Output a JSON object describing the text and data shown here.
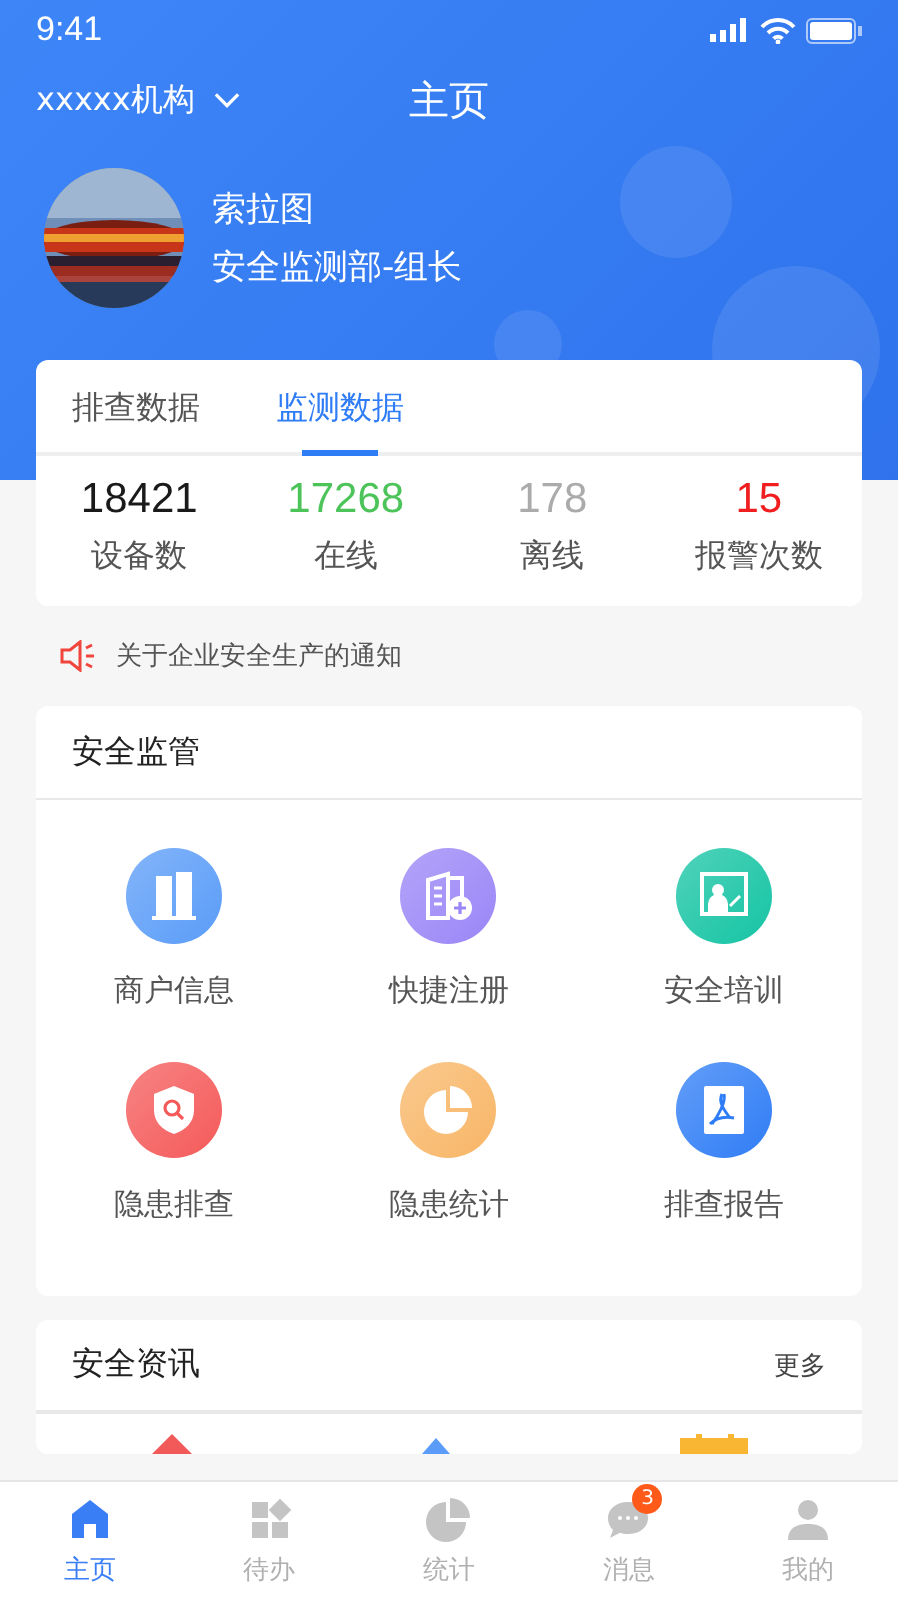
{
  "status_bar": {
    "time": "9:41"
  },
  "header": {
    "org": "xxxxx机构",
    "title": "主页"
  },
  "profile": {
    "name": "索拉图",
    "role": "安全监测部-组长"
  },
  "tabs": [
    {
      "label": "排查数据",
      "selected": false
    },
    {
      "label": "监测数据",
      "selected": true
    }
  ],
  "stats": [
    {
      "value": "18421",
      "label": "设备数",
      "color": "#1a1a1a"
    },
    {
      "value": "17268",
      "label": "在线",
      "color": "#4cc45a"
    },
    {
      "value": "178",
      "label": "离线",
      "color": "#ababab"
    },
    {
      "value": "15",
      "label": "报警次数",
      "color": "#f01e1e"
    }
  ],
  "notice": {
    "text": "关于企业安全生产的通知"
  },
  "supervision": {
    "title": "安全监管",
    "items": [
      {
        "label": "商户信息",
        "kind": "building",
        "color": "#5a9cf8"
      },
      {
        "label": "快捷注册",
        "kind": "register",
        "color": "#9b86f7"
      },
      {
        "label": "安全培训",
        "kind": "training",
        "color": "#15c4a4"
      },
      {
        "label": "隐患排查",
        "kind": "shield",
        "color": "#f55a5a"
      },
      {
        "label": "隐患统计",
        "kind": "pie",
        "color": "#f8b667"
      },
      {
        "label": "排查报告",
        "kind": "report",
        "color": "#2f7df6"
      }
    ]
  },
  "news": {
    "title": "安全资讯",
    "more": "更多"
  },
  "tab_bar": [
    {
      "label": "主页",
      "kind": "home",
      "selected": true
    },
    {
      "label": "待办",
      "kind": "grid",
      "selected": false
    },
    {
      "label": "统计",
      "kind": "pie",
      "selected": false
    },
    {
      "label": "消息",
      "kind": "chat",
      "selected": false,
      "badge": "3"
    },
    {
      "label": "我的",
      "kind": "person",
      "selected": false
    }
  ]
}
